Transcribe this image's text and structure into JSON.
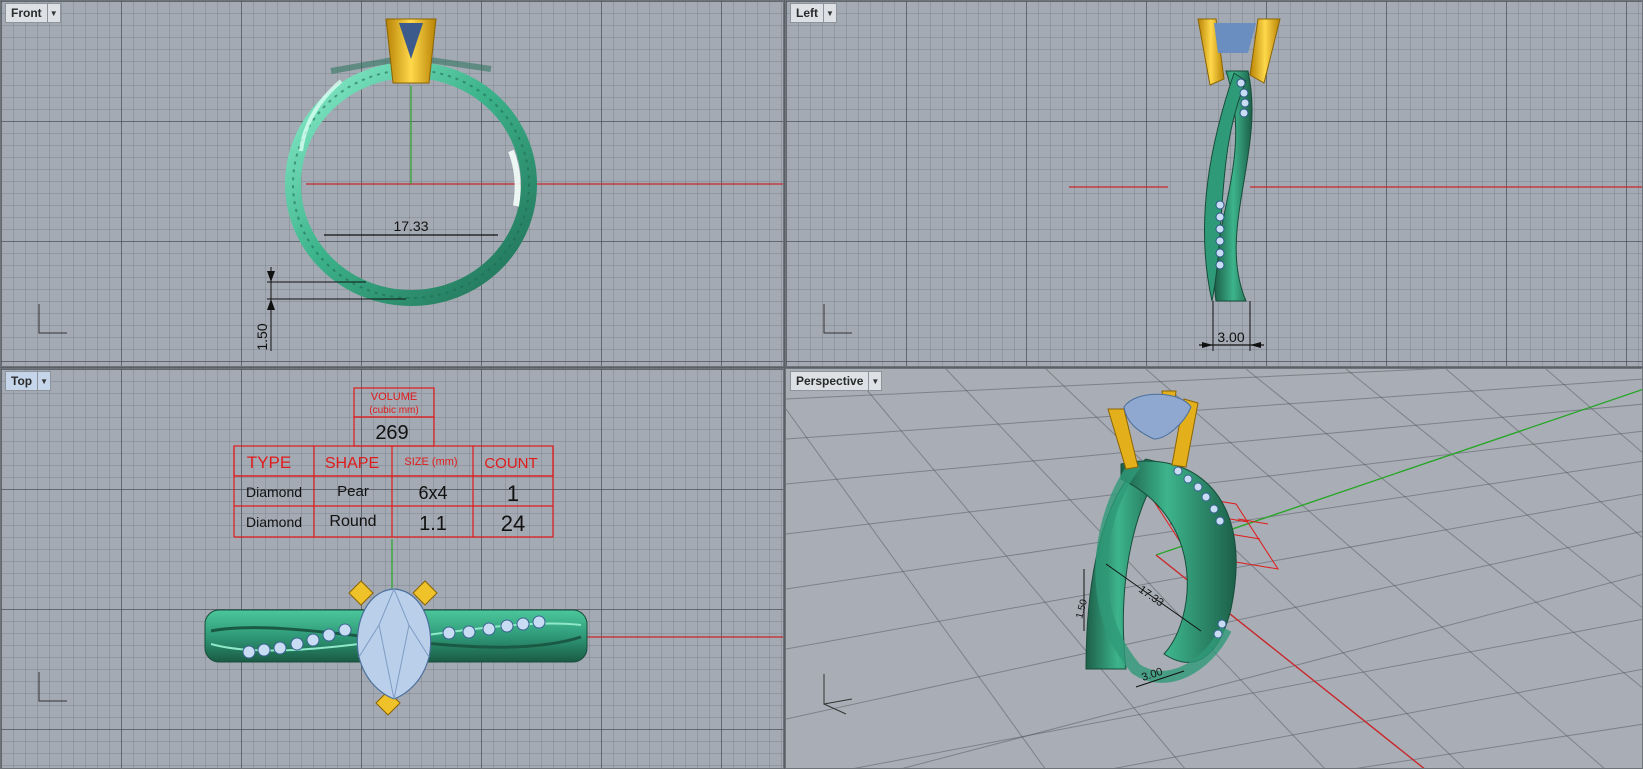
{
  "viewports": {
    "front": {
      "label": "Front",
      "dimension_width": "17.33",
      "dimension_thickness": "1.50"
    },
    "left": {
      "label": "Left",
      "dimension_width": "3.00"
    },
    "top": {
      "label": "Top"
    },
    "perspective": {
      "label": "Perspective",
      "dimension_width": "17.33",
      "dimension_thickness": "1.50",
      "dimension_band": "3.00"
    }
  },
  "spec_table": {
    "volume_label_1": "VOLUME",
    "volume_label_2": "(cubic mm)",
    "volume_value": "269",
    "headers": {
      "type": "TYPE",
      "shape": "SHAPE",
      "size": "SIZE (mm)",
      "count": "COUNT"
    },
    "rows": [
      {
        "type": "Diamond",
        "shape": "Pear",
        "size": "6x4",
        "count": "1"
      },
      {
        "type": "Diamond",
        "shape": "Round",
        "size": "1.1",
        "count": "24"
      }
    ]
  },
  "colors": {
    "band": "#2f9a78",
    "band_light": "#7fe0bf",
    "prong_gold": "#e3b01c",
    "gem": "#b9cfea",
    "axis_red": "#c8282a",
    "axis_green": "#2aa52a",
    "annotation_red": "#e01b1b"
  }
}
